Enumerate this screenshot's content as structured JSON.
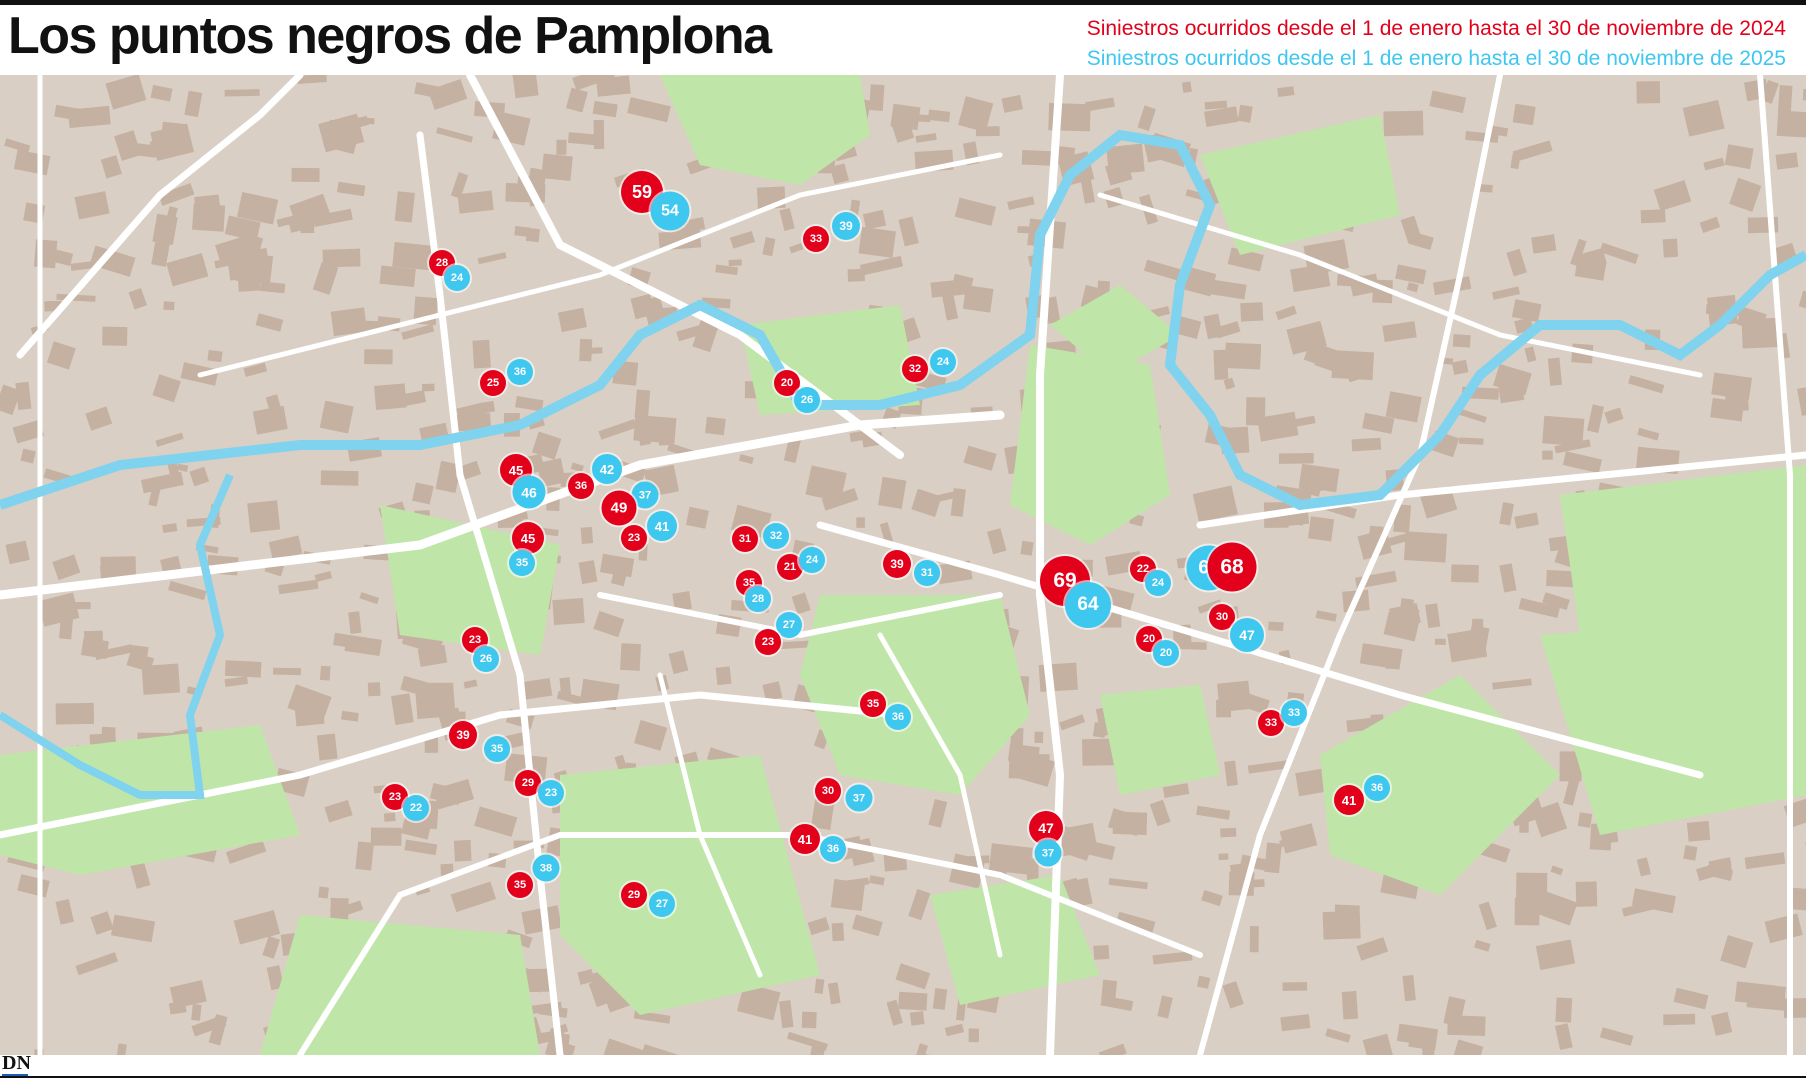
{
  "title": "Los puntos negros de Pamplona",
  "legend": {
    "y2024": "Siniestros ocurridos desde el 1 de enero hasta el 30 de noviembre de 2024",
    "y2025": "Siniestros ocurridos desde el 1 de enero hasta el 30 de noviembre de 2025"
  },
  "colors": {
    "y2024": "#e3001b",
    "y2025": "#3ec7ef",
    "river": "#7fd3ee",
    "park": "#bfe6a8",
    "block": "#c7b3a4",
    "ground": "#d9cfc4"
  },
  "logo": "DN",
  "markers": [
    {
      "year": "2024",
      "value": 59
    },
    {
      "year": "2025",
      "value": 54
    },
    {
      "year": "2024",
      "value": 33
    },
    {
      "year": "2025",
      "value": 39
    },
    {
      "year": "2024",
      "value": 28
    },
    {
      "year": "2025",
      "value": 24
    },
    {
      "year": "2024",
      "value": 25
    },
    {
      "year": "2025",
      "value": 36
    },
    {
      "year": "2024",
      "value": 20
    },
    {
      "year": "2025",
      "value": 26
    },
    {
      "year": "2024",
      "value": 32
    },
    {
      "year": "2025",
      "value": 24
    },
    {
      "year": "2024",
      "value": 45
    },
    {
      "year": "2025",
      "value": 46
    },
    {
      "year": "2025",
      "value": 42
    },
    {
      "year": "2024",
      "value": 36
    },
    {
      "year": "2025",
      "value": 37
    },
    {
      "year": "2024",
      "value": 49
    },
    {
      "year": "2025",
      "value": 41
    },
    {
      "year": "2024",
      "value": 45
    },
    {
      "year": "2024",
      "value": 23
    },
    {
      "year": "2025",
      "value": 35
    },
    {
      "year": "2024",
      "value": 31
    },
    {
      "year": "2025",
      "value": 32
    },
    {
      "year": "2024",
      "value": 21
    },
    {
      "year": "2025",
      "value": 24
    },
    {
      "year": "2024",
      "value": 35
    },
    {
      "year": "2025",
      "value": 28
    },
    {
      "year": "2025",
      "value": 27
    },
    {
      "year": "2024",
      "value": 23
    },
    {
      "year": "2024",
      "value": 39
    },
    {
      "year": "2025",
      "value": 31
    },
    {
      "year": "2024",
      "value": 69
    },
    {
      "year": "2025",
      "value": 64
    },
    {
      "year": "2024",
      "value": 22
    },
    {
      "year": "2025",
      "value": 24
    },
    {
      "year": "2025",
      "value": 63
    },
    {
      "year": "2024",
      "value": 68
    },
    {
      "year": "2024",
      "value": 30
    },
    {
      "year": "2025",
      "value": 47
    },
    {
      "year": "2024",
      "value": 20
    },
    {
      "year": "2025",
      "value": 20
    },
    {
      "year": "2024",
      "value": 23
    },
    {
      "year": "2025",
      "value": 26
    },
    {
      "year": "2024",
      "value": 35
    },
    {
      "year": "2025",
      "value": 36
    },
    {
      "year": "2024",
      "value": 33
    },
    {
      "year": "2025",
      "value": 33
    },
    {
      "year": "2024",
      "value": 39
    },
    {
      "year": "2025",
      "value": 35
    },
    {
      "year": "2024",
      "value": 29
    },
    {
      "year": "2025",
      "value": 23
    },
    {
      "year": "2024",
      "value": 23
    },
    {
      "year": "2025",
      "value": 22
    },
    {
      "year": "2024",
      "value": 30
    },
    {
      "year": "2025",
      "value": 37
    },
    {
      "year": "2024",
      "value": 41
    },
    {
      "year": "2025",
      "value": 36
    },
    {
      "year": "2024",
      "value": 47
    },
    {
      "year": "2025",
      "value": 37
    },
    {
      "year": "2024",
      "value": 41
    },
    {
      "year": "2025",
      "value": 36
    },
    {
      "year": "2024",
      "value": 35
    },
    {
      "year": "2025",
      "value": 38
    },
    {
      "year": "2024",
      "value": 29
    },
    {
      "year": "2025",
      "value": 27
    }
  ]
}
